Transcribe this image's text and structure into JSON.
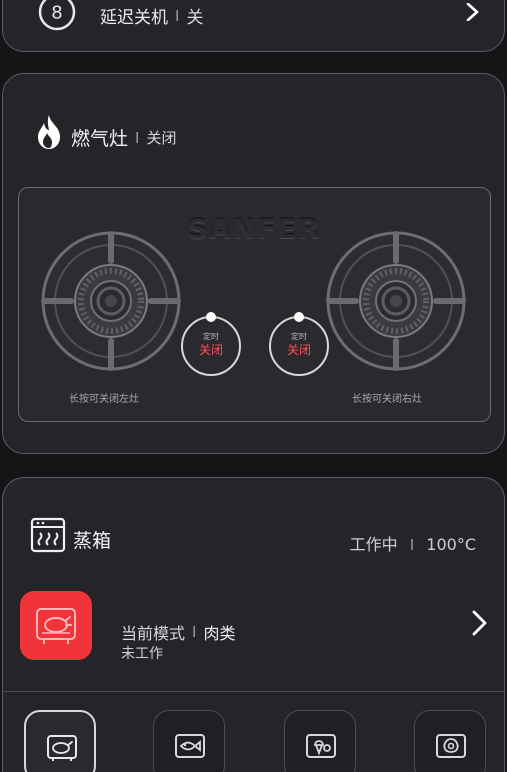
{
  "delay_off": {
    "title": "延迟关机",
    "separator": "I",
    "value": "关",
    "icon": "timer-8-icon"
  },
  "gas_stove": {
    "title": "燃气灶",
    "separator": "I",
    "status": "关闭",
    "icon": "flame-icon",
    "brand": "SANFER",
    "left_timer": {
      "label": "定时",
      "state": "关闭"
    },
    "right_timer": {
      "label": "定时",
      "state": "关闭"
    },
    "left_hint": "长按可关闭左灶",
    "right_hint": "长按可关闭右灶"
  },
  "steamer": {
    "title": "蒸箱",
    "icon": "steam-oven-icon",
    "status": "工作中",
    "separator": "I",
    "temperature": "100°C",
    "mode_label": "当前模式",
    "mode_separator": "I",
    "mode_value": "肉类",
    "work_status": "未工作",
    "mode_icon": "roast-chicken-icon",
    "mode_buttons": [
      "meat-mode-icon",
      "fish-mode-icon",
      "dessert-mode-icon",
      "egg-mode-icon"
    ],
    "accent_color": "#f0343a"
  }
}
